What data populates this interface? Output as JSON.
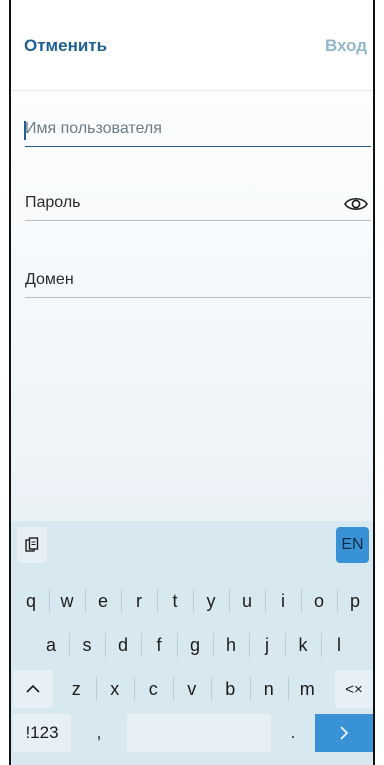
{
  "header": {
    "cancel_label": "Отменить",
    "login_label": "Вход"
  },
  "form": {
    "username_placeholder": "Имя пользователя",
    "password_label": "Пароль",
    "domain_label": "Домен",
    "password_visibility_icon": "eye-icon"
  },
  "keyboard": {
    "clipboard_icon": "clipboard-icon",
    "language_label": "EN",
    "row1": [
      "q",
      "w",
      "e",
      "r",
      "t",
      "y",
      "u",
      "i",
      "o",
      "p"
    ],
    "row2": [
      "a",
      "s",
      "d",
      "f",
      "g",
      "h",
      "j",
      "k",
      "l"
    ],
    "row3": [
      "z",
      "x",
      "c",
      "v",
      "b",
      "n",
      "m"
    ],
    "shift_label": "^",
    "backspace_label": "<×",
    "symbols_label": "!123",
    "comma_label": ",",
    "period_label": ".",
    "enter_label": ">"
  },
  "colors": {
    "accent": "#1f5f93",
    "disabled_accent": "#93b6cc",
    "keyboard_bg": "#d8e8f1",
    "key_blue": "#3a92d6"
  }
}
